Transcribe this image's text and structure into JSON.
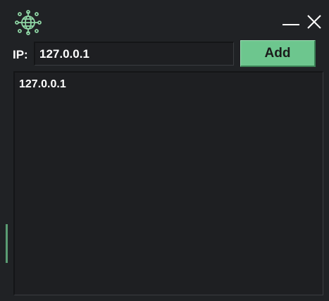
{
  "titlebar": {
    "app_icon": "globe-network-icon",
    "minimize_icon": "minimize-icon",
    "close_icon": "close-icon"
  },
  "form": {
    "ip_label": "IP:",
    "ip_value": "127.0.0.1",
    "add_label": "Add"
  },
  "ip_list": {
    "items": [
      "127.0.0.1"
    ]
  },
  "colors": {
    "background": "#202225",
    "field": "#1e1f22",
    "accent": "#6dc68e",
    "icon": "#8fd6a5",
    "text": "#ffffff"
  }
}
